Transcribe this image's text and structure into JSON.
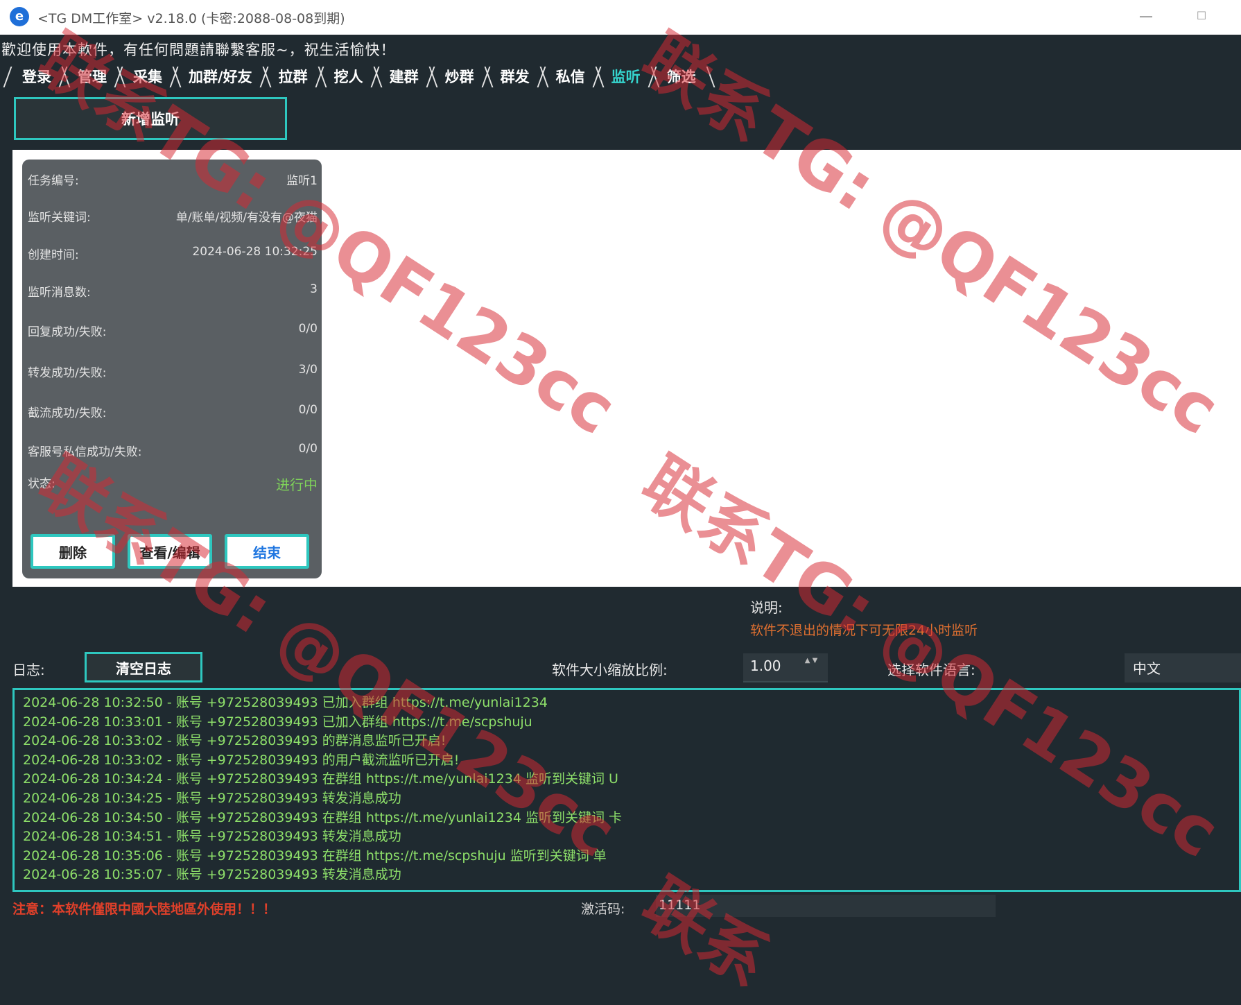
{
  "window": {
    "icon_glyph": "e",
    "title": "<TG DM工作室> v2.18.0 (卡密:2088-08-08到期)",
    "minimize_glyph": "—",
    "maximize_glyph": "☐"
  },
  "welcome": "歡迎使用本軟件，有任何問題請聯繫客服~，祝生活愉快！",
  "tabs": [
    {
      "label": "登录"
    },
    {
      "label": "管理"
    },
    {
      "label": "采集"
    },
    {
      "label": "加群/好友"
    },
    {
      "label": "拉群"
    },
    {
      "label": "挖人"
    },
    {
      "label": "建群"
    },
    {
      "label": "炒群"
    },
    {
      "label": "群发"
    },
    {
      "label": "私信"
    },
    {
      "label": "监听",
      "active": true
    },
    {
      "label": "筛选"
    }
  ],
  "add_button": "新增监听",
  "task": {
    "fields": [
      {
        "label": "任务编号:",
        "value": "监听1"
      },
      {
        "label": "监听关键词:",
        "value": "单/账单/视频/有没有@夜猫"
      },
      {
        "label": "创建时间:",
        "value": "2024-06-28 10:32:25"
      },
      {
        "label": "监听消息数:",
        "value": "3"
      },
      {
        "label": "回复成功/失败:",
        "value": "0/0"
      },
      {
        "label": "转发成功/失败:",
        "value": "3/0"
      },
      {
        "label": "截流成功/失败:",
        "value": "0/0"
      },
      {
        "label": "客服号私信成功/失败:",
        "value": "0/0"
      }
    ],
    "status_label": "状态:",
    "status_value": "进行中",
    "buttons": {
      "delete": "删除",
      "view_edit": "查看/编辑",
      "end": "结束"
    }
  },
  "description": {
    "label": "说明:",
    "text": "软件不退出的情况下可无限24小时监听"
  },
  "log": {
    "label": "日志:",
    "clear_button": "清空日志",
    "lines": [
      "2024-06-28 10:32:50 - 账号 +972528039493 已加入群组 https://t.me/yunlai1234",
      "2024-06-28 10:33:01 - 账号 +972528039493 已加入群组 https://t.me/scpshuju",
      "2024-06-28 10:33:02 - 账号 +972528039493 的群消息监听已开启!",
      "2024-06-28 10:33:02 - 账号 +972528039493 的用户截流监听已开启!",
      "2024-06-28 10:34:24 - 账号 +972528039493 在群组 https://t.me/yunlai1234 监听到关键词 U",
      "2024-06-28 10:34:25 - 账号 +972528039493 转发消息成功",
      "2024-06-28 10:34:50 - 账号 +972528039493 在群组 https://t.me/yunlai1234 监听到关键词 卡",
      "2024-06-28 10:34:51 - 账号 +972528039493 转发消息成功",
      "2024-06-28 10:35:06 - 账号 +972528039493 在群组 https://t.me/scpshuju 监听到关键词 单",
      "2024-06-28 10:35:07 - 账号 +972528039493 转发消息成功"
    ]
  },
  "scale": {
    "label": "软件大小缩放比例:",
    "value": "1.00",
    "stepper_glyph": "▲ ▼"
  },
  "language": {
    "label": "选择软件语言:",
    "value": "中文"
  },
  "footer": {
    "notice": "注意：本软件僅限中國大陸地區外使用！！！",
    "activation_label": "激活码:",
    "activation_value": "11111"
  },
  "watermarks": [
    "联系TG: @QF123cc",
    "联系TG: @QF123cc",
    "联系TG: @QF123cc",
    "联系TG: @QF123cc",
    "联系"
  ],
  "colors": {
    "accent": "#2ec7bf",
    "status_green": "#7fd35a",
    "log_text": "#8ee06a",
    "warning": "#e07030",
    "watermark": "#d72832"
  }
}
